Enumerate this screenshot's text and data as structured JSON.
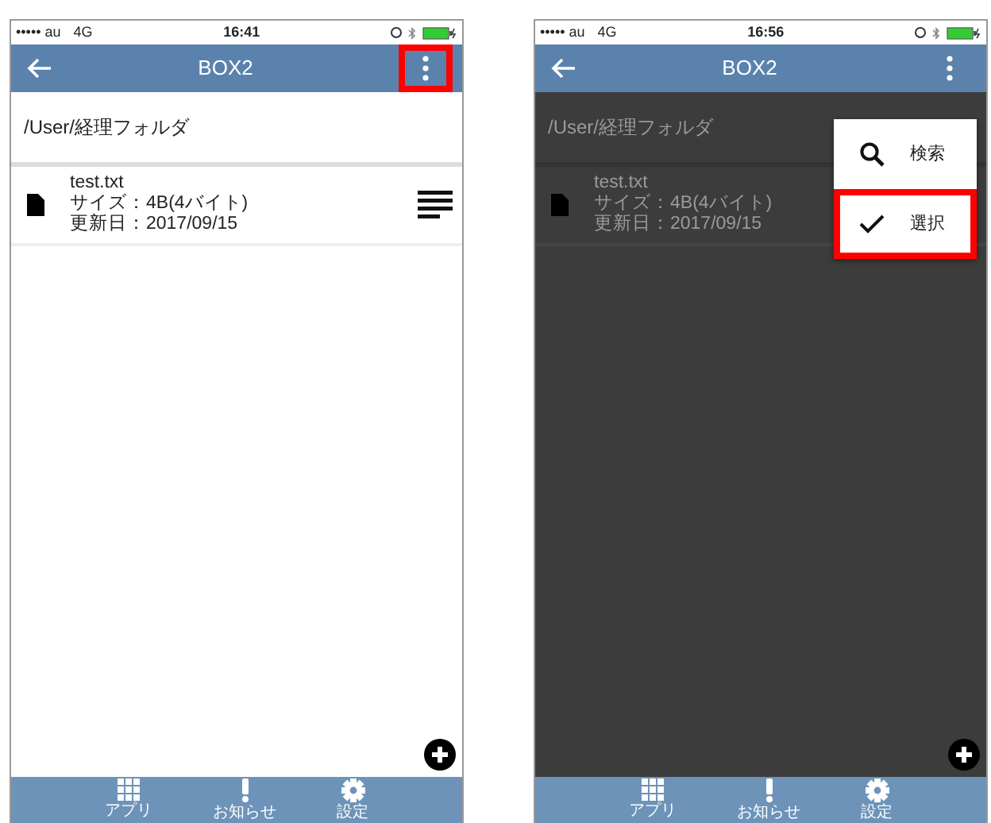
{
  "screens": [
    {
      "dimmed": false,
      "status_bar": {
        "carrier": "••••• au",
        "network": "4G",
        "time": "16:41"
      },
      "title": "BOX2",
      "menu_button_highlighted": true,
      "path": "/User/経理フォルダ",
      "files": [
        {
          "name": "test.txt",
          "size": "サイズ：4B(4バイト)",
          "date": "更新日：2017/09/15",
          "menu_icon": true
        }
      ],
      "tabs": [
        {
          "kind": "apps",
          "label": "アプリ"
        },
        {
          "kind": "notice",
          "label": "お知らせ"
        },
        {
          "kind": "settings",
          "label": "設定"
        }
      ]
    },
    {
      "dimmed": true,
      "status_bar": {
        "carrier": "••••• au",
        "network": "4G",
        "time": "16:56"
      },
      "title": "BOX2",
      "menu_button_highlighted": false,
      "path": "/User/経理フォルダ",
      "files": [
        {
          "name": "test.txt",
          "size": "サイズ：4B(4バイト)",
          "date": "更新日：2017/09/15",
          "menu_icon": false
        }
      ],
      "menu": [
        {
          "kind": "search",
          "label": "検索",
          "highlighted": false
        },
        {
          "kind": "select",
          "label": "選択",
          "highlighted": true
        }
      ],
      "tabs": [
        {
          "kind": "apps",
          "label": "アプリ"
        },
        {
          "kind": "notice",
          "label": "お知らせ"
        },
        {
          "kind": "settings",
          "label": "設定"
        }
      ]
    }
  ]
}
